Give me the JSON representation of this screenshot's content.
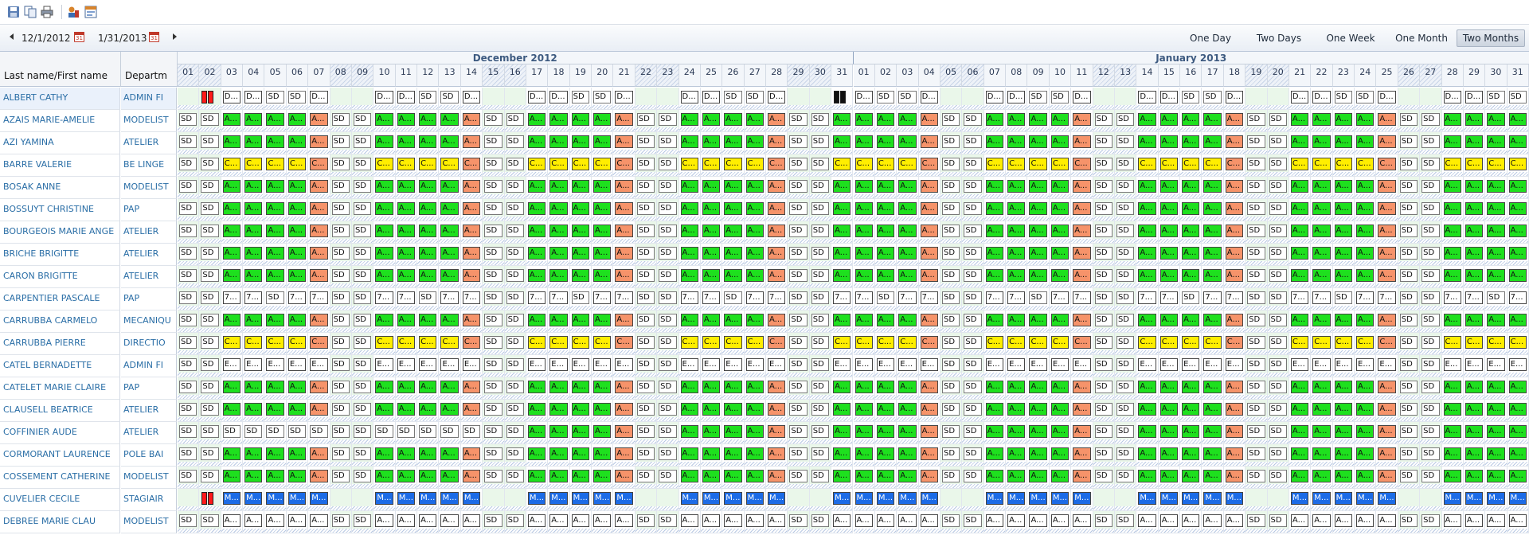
{
  "toolbar": {
    "icons": [
      "save-icon",
      "copy-icon",
      "print-icon",
      "resource-icon",
      "calendar-list-icon"
    ]
  },
  "navigation": {
    "start_date": "12/1/2012",
    "end_date": "1/31/2013",
    "calendar_day_label": "31",
    "view_buttons": [
      "One Day",
      "Two Days",
      "One Week",
      "One Month",
      "Two Months"
    ],
    "active_view": "Two Months"
  },
  "months": [
    "December 2012",
    "January 2013"
  ],
  "columns": {
    "name_header": "Last name/First name",
    "dept_header": "Departm"
  },
  "days": [
    "01",
    "02",
    "03",
    "04",
    "05",
    "06",
    "07",
    "08",
    "09",
    "10",
    "11",
    "12",
    "13",
    "14",
    "15",
    "16",
    "17",
    "18",
    "19",
    "20",
    "21",
    "22",
    "23",
    "24",
    "25",
    "26",
    "27",
    "28",
    "29",
    "30",
    "31",
    "01",
    "02",
    "03",
    "04",
    "05",
    "06",
    "07",
    "08",
    "09",
    "10",
    "11",
    "12",
    "13",
    "14",
    "15",
    "16",
    "17",
    "18",
    "19",
    "20",
    "21",
    "22",
    "23",
    "24",
    "25",
    "26",
    "27",
    "28",
    "29",
    "30",
    "31"
  ],
  "weekend_indices": [
    0,
    1,
    7,
    8,
    14,
    15,
    21,
    22,
    28,
    29,
    35,
    36,
    42,
    43,
    49,
    50,
    56,
    57
  ],
  "colors": {
    "work": "#1ee01e",
    "half_day": "#f6936a",
    "c_shift": "#ffee00",
    "m_shift": "#1c6be6",
    "absence": "#ff1a1a",
    "holiday": "#111111"
  },
  "rows": [
    {
      "name": "ALBERT CATHY",
      "dept": "ADMIN FI",
      "pattern": "D_white"
    },
    {
      "name": "AZAIS MARIE-AMELIE",
      "dept": "MODELIST",
      "pattern": "A_green"
    },
    {
      "name": "AZI YAMINA",
      "dept": "ATELIER",
      "pattern": "A_green"
    },
    {
      "name": "BARRE VALERIE",
      "dept": "BE LINGE",
      "pattern": "C_yellow"
    },
    {
      "name": "BOSAK ANNE",
      "dept": "MODELIST",
      "pattern": "A_green"
    },
    {
      "name": "BOSSUYT CHRISTINE",
      "dept": "PAP",
      "pattern": "A_green"
    },
    {
      "name": "BOURGEOIS MARIE ANGE",
      "dept": "ATELIER",
      "pattern": "A_green"
    },
    {
      "name": "BRICHE BRIGITTE",
      "dept": "ATELIER",
      "pattern": "A_green"
    },
    {
      "name": "CARON BRIGITTE",
      "dept": "ATELIER",
      "pattern": "A_green"
    },
    {
      "name": "CARPENTIER PASCALE",
      "dept": "PAP",
      "pattern": "7_white"
    },
    {
      "name": "CARRUBBA CARMELO",
      "dept": "MECANIQU",
      "pattern": "A_green"
    },
    {
      "name": "CARRUBBA PIERRE",
      "dept": "DIRECTIO",
      "pattern": "C_yellow"
    },
    {
      "name": "CATEL BERNADETTE",
      "dept": "ADMIN FI",
      "pattern": "E_white"
    },
    {
      "name": "CATELET MARIE CLAIRE",
      "dept": "PAP",
      "pattern": "A_green"
    },
    {
      "name": "CLAUSELL BEATRICE",
      "dept": "ATELIER",
      "pattern": "A_green"
    },
    {
      "name": "COFFINIER AUDE",
      "dept": "ATELIER",
      "pattern": "SD_green"
    },
    {
      "name": "CORMORANT LAURENCE",
      "dept": "POLE BAI",
      "pattern": "A_green"
    },
    {
      "name": "COSSEMENT CATHERINE",
      "dept": "MODELIST",
      "pattern": "A_green"
    },
    {
      "name": "CUVELIER CECILE",
      "dept": "STAGIAIR",
      "pattern": "M_blue"
    },
    {
      "name": "DEBREE MARIE CLAU",
      "dept": "MODELIST",
      "pattern": "A_white"
    }
  ],
  "labels": {
    "sd": "SD",
    "A": "A...",
    "C": "C...",
    "D": "D...",
    "E": "E...",
    "M": "M...",
    "seven": "7..."
  }
}
